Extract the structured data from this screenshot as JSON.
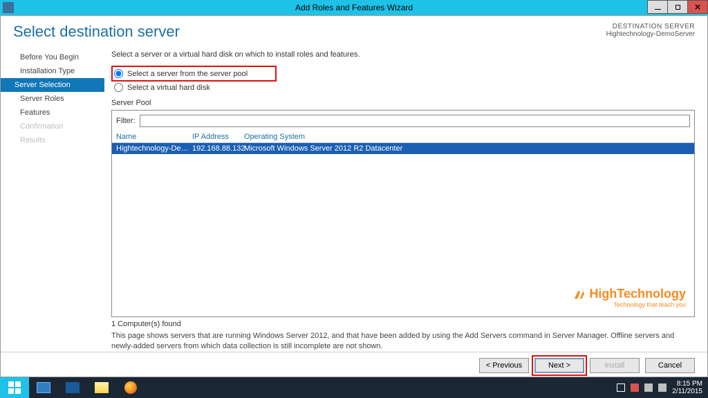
{
  "titlebar": {
    "title": "Add Roles and Features Wizard"
  },
  "header": {
    "page_title": "Select destination server",
    "dest_label": "DESTINATION SERVER",
    "dest_value": "Hightechnology-DemoServer"
  },
  "nav": {
    "items": [
      {
        "label": "Before You Begin",
        "state": "normal"
      },
      {
        "label": "Installation Type",
        "state": "normal"
      },
      {
        "label": "Server Selection",
        "state": "selected"
      },
      {
        "label": "Server Roles",
        "state": "normal"
      },
      {
        "label": "Features",
        "state": "normal"
      },
      {
        "label": "Confirmation",
        "state": "disabled"
      },
      {
        "label": "Results",
        "state": "disabled"
      }
    ]
  },
  "content": {
    "intro": "Select a server or a virtual hard disk on which to install roles and features.",
    "radio1": "Select a server from the server pool",
    "radio2": "Select a virtual hard disk",
    "pool_label": "Server Pool",
    "filter_label": "Filter:",
    "filter_value": "",
    "columns": {
      "name": "Name",
      "ip": "IP Address",
      "os": "Operating System"
    },
    "rows": [
      {
        "name": "Hightechnology-DemoS...",
        "ip": "192.168.88.132",
        "os": "Microsoft Windows Server 2012 R2 Datacenter"
      }
    ],
    "found_text": "1 Computer(s) found",
    "explain": "This page shows servers that are running Windows Server 2012, and that have been added by using the Add Servers command in Server Manager. Offline servers and newly-added servers from which data collection is still incomplete are not shown."
  },
  "watermark": {
    "brand": "HighTechnology",
    "tag": "Technology that teach you"
  },
  "footer": {
    "previous": "< Previous",
    "next": "Next >",
    "install": "Install",
    "cancel": "Cancel"
  },
  "taskbar": {
    "time": "8:15 PM",
    "date": "2/11/2015"
  }
}
